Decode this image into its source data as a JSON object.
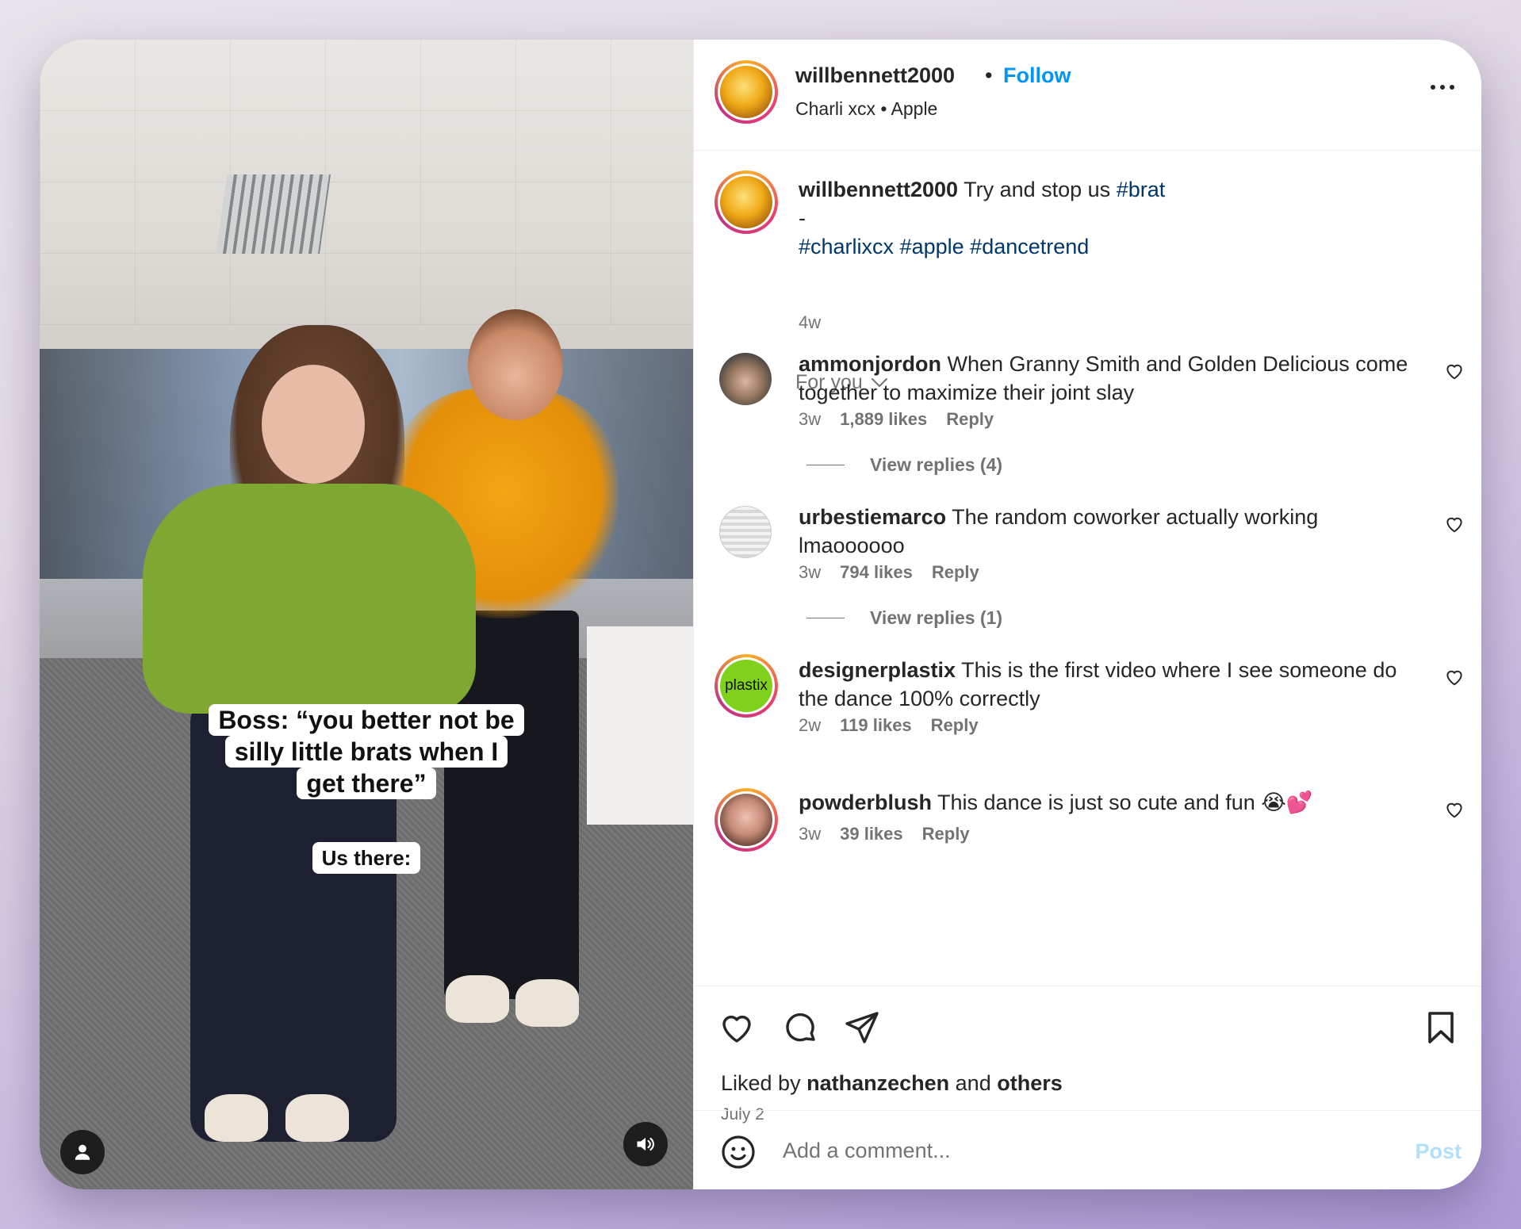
{
  "video": {
    "overlay_lines": [
      "Boss: “you better not be",
      "silly little brats when I",
      "get there”"
    ],
    "overlay_small": "Us there:",
    "buttons": {
      "user_icon": "person-icon",
      "audio_icon": "speaker-icon"
    }
  },
  "header": {
    "username": "willbennett2000",
    "separator": "•",
    "follow_label": "Follow",
    "subtitle": "Charli xcx • Apple"
  },
  "caption": {
    "username": "willbennett2000",
    "text": "Try and stop us",
    "tag_first": "#brat",
    "dash": "-",
    "tags": [
      "#charlixcx",
      "#apple",
      "#dancetrend"
    ],
    "time": "4w"
  },
  "sort": {
    "label": "For you"
  },
  "comments": [
    {
      "user": "ammonjordon",
      "text": "When Granny Smith and Golden Delicious come together to maximize their joint slay",
      "time": "3w",
      "likes": "1,889 likes",
      "reply": "Reply",
      "view_replies": "View replies (4)"
    },
    {
      "user": "urbestiemarco",
      "text": "The random coworker actually working lmaoooooo",
      "time": "3w",
      "likes": "794 likes",
      "reply": "Reply",
      "view_replies": "View replies (1)"
    },
    {
      "user": "designerplastix",
      "avatar_text": "plastix",
      "text": "This is the first video where I see someone do the dance 100% correctly",
      "time": "2w",
      "likes": "119 likes",
      "reply": "Reply"
    },
    {
      "user": "powderblush",
      "text": "This dance is just so cute and fun 😭💕",
      "time": "3w",
      "likes": "39 likes",
      "reply": "Reply"
    }
  ],
  "actions": {
    "liked_prefix": "Liked by",
    "liked_user": "nathanzechen",
    "liked_and": "and",
    "liked_others": "others",
    "date": "July 2"
  },
  "composer": {
    "placeholder": "Add a comment...",
    "post_label": "Post"
  },
  "colors": {
    "accent": "#0095f6",
    "hashtag": "#00376b",
    "muted": "#737373",
    "text": "#262626",
    "post_disabled": "#b2dffc"
  }
}
